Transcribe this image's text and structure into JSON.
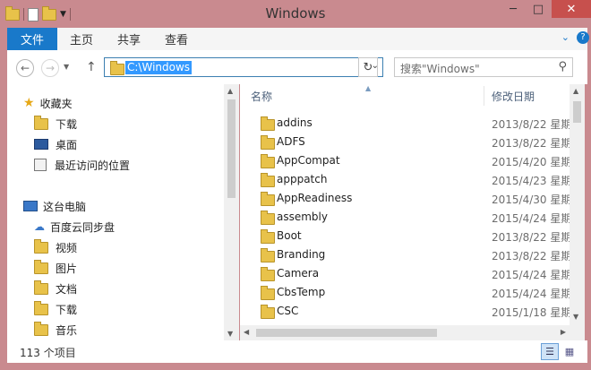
{
  "window": {
    "title": "Windows"
  },
  "ribbon": {
    "file": "文件",
    "tabs": [
      "主页",
      "共享",
      "查看"
    ]
  },
  "address": {
    "path": "C:\\Windows"
  },
  "search": {
    "placeholder": "搜索\"Windows\""
  },
  "nav": {
    "favorites": {
      "label": "收藏夹",
      "items": [
        "下载",
        "桌面",
        "最近访问的位置"
      ]
    },
    "thispc": {
      "label": "这台电脑",
      "items": [
        "百度云同步盘",
        "视频",
        "图片",
        "文档",
        "下载",
        "音乐"
      ]
    }
  },
  "columns": {
    "name": "名称",
    "modified": "修改日期"
  },
  "files": [
    {
      "name": "addins",
      "date": "2013/8/22 星期"
    },
    {
      "name": "ADFS",
      "date": "2013/8/22 星期"
    },
    {
      "name": "AppCompat",
      "date": "2015/4/20 星期"
    },
    {
      "name": "apppatch",
      "date": "2015/4/23 星期"
    },
    {
      "name": "AppReadiness",
      "date": "2015/4/30 星期"
    },
    {
      "name": "assembly",
      "date": "2015/4/24 星期"
    },
    {
      "name": "Boot",
      "date": "2013/8/22 星期"
    },
    {
      "name": "Branding",
      "date": "2013/8/22 星期"
    },
    {
      "name": "Camera",
      "date": "2015/4/24 星期"
    },
    {
      "name": "CbsTemp",
      "date": "2015/4/24 星期"
    },
    {
      "name": "CSC",
      "date": "2015/1/18 星期"
    }
  ],
  "status": {
    "count": "113 个项目"
  }
}
